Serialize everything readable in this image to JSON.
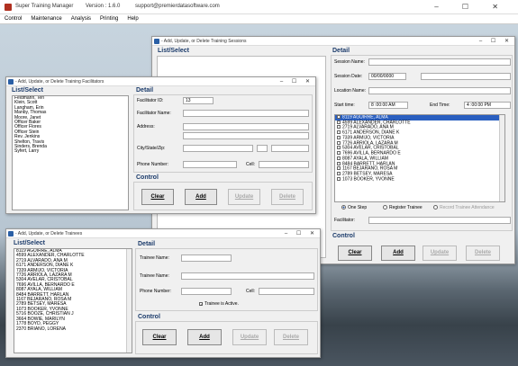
{
  "app": {
    "title": "Super Training Manager",
    "version": "Version : 1.6.0",
    "email": "support@premierdatasoftware.com",
    "controls": "–  ☐  ✕"
  },
  "menu": [
    "Control",
    "Maintenance",
    "Analysis",
    "Printing",
    "Help"
  ],
  "win_controls": "–  ☐  ✕",
  "sessions": {
    "title": "- Add, Update, or Delete Training Sessions",
    "list_header": "List/Select",
    "detail_header": "Detail",
    "session_name_label": "Session Name:",
    "session_date_label": "Session Date:",
    "session_date_value": "00/00/0000",
    "location_label": "Location Name:",
    "start_label": "Start time:",
    "start_value": "8 :00:00 AM",
    "end_label": "End Time:",
    "end_value": "4 :00:00 PM",
    "trainees": [
      "8119 AGUIRRE, ALMA",
      "4599 ALEXANDER, CHARLOTTE",
      "2719 ALVARADO, ANA M",
      "6171 ANDERSON, DIANE K",
      "7339 ARMIJO, VICTORIA",
      "7726 ARRIOLA, LAZARA M",
      "5304 AVELAR, CRISTOBAL",
      "7696 AVILLA, BERNARDO E",
      "8087 AYALA, WILLIAM",
      "8484 BARRETT, HARLAN",
      "1167 BEJARANO, ROSA M",
      "2789 BETSEY, MARESA",
      "1073 BOOKER, YVONNE"
    ],
    "radio_one": "One Step",
    "radio_register": "Register Trainee",
    "radio_record": "Record Trainee Attendance",
    "facilitator_label": "Facilitator:",
    "control_header": "Control",
    "clear": "Clear",
    "add": "Add",
    "update": "Update",
    "delete": "Delete"
  },
  "facilitators": {
    "title": "- Add, Update, or Delete Training Facilitators",
    "list_header": "List/Select",
    "detail_header": "Detail",
    "items": [
      "Feldmann, Teri",
      "Klein, Scott",
      "Langham, Erin",
      "Manby, Thomas",
      "Moore, Janet",
      "Officer Baker",
      "Officer Flores",
      "Officer Stein",
      "Rev. Jenkins",
      "Shelton, Travis",
      "Sinders, Brenda",
      "Syfert, Larry"
    ],
    "id_label": "Facilitator ID:",
    "id_value": "13",
    "name_label": "Facilitator Name:",
    "address_label": "Address:",
    "city_label": "City/State/Zip:",
    "phone_label": "Phone Number:",
    "cell_label": "Cell:",
    "control_header": "Control",
    "clear": "Clear",
    "add": "Add",
    "update": "Update",
    "delete": "Delete"
  },
  "trainees": {
    "title": "- Add, Update, or Delete Trainees",
    "list_header": "List/Select",
    "detail_header": "Detail",
    "items": [
      "8119 AGUIRRE, ALMA",
      "4599 ALEXANDER, CHARLOTTE",
      "2719 ALVARADO, ANA M",
      "6171 ANDERSON, DIANE K",
      "7339 ARMIJO, VICTORIA",
      "7726 ARRIOLA, LAZARA M",
      "5304 AVELAR, CRISTOBAL",
      "7696 AVILLA, BERNARDO E",
      "8087 AYALA, WILLIAM",
      "8484 BARRETT, HARLAN",
      "1167 BEJARANO, ROSA M",
      "2789 BETSEY, MARESA",
      "1073 BOOKER, YVONNE",
      "5716 BOOZE, CHRISTIAN J",
      "3664 BOWIE, MARILYN",
      "1778 BOYD, PEGGY",
      "2370 BRIANO, LORENA"
    ],
    "name_label": "Trainee Name:",
    "name2_label": "Trainee Name:",
    "phone_label": "Phone Number:",
    "cell_label": "Cell:",
    "active_label": "Trainee is Active.",
    "control_header": "Control",
    "clear": "Clear",
    "add": "Add",
    "update": "Update",
    "delete": "Delete"
  }
}
